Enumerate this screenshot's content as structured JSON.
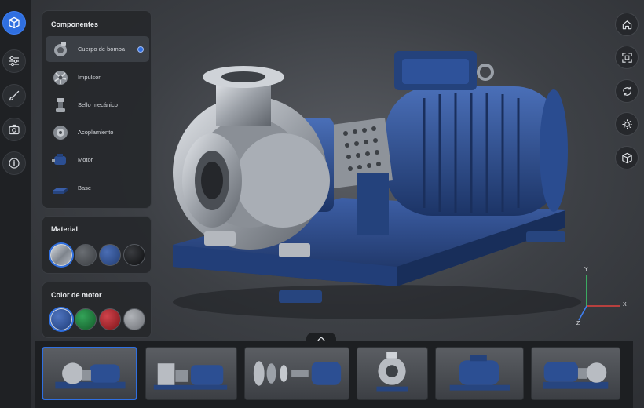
{
  "components_panel": {
    "title": "Componentes",
    "items": [
      {
        "label": "Cuerpo de bomba",
        "selected": true,
        "icon": "pump-casing-icon"
      },
      {
        "label": "Impulsor",
        "selected": false,
        "icon": "impeller-icon"
      },
      {
        "label": "Sello mecánico",
        "selected": false,
        "icon": "mechanical-seal-icon"
      },
      {
        "label": "Acoplamiento",
        "selected": false,
        "icon": "coupling-icon"
      },
      {
        "label": "Motor",
        "selected": false,
        "icon": "motor-icon"
      },
      {
        "label": "Base",
        "selected": false,
        "icon": "base-icon"
      }
    ]
  },
  "material_panel": {
    "title": "Material",
    "swatches": [
      {
        "name": "stainless-steel",
        "color": "#9aa0a8",
        "selected": true
      },
      {
        "name": "gray-iron",
        "color": "#4a4d52",
        "selected": false
      },
      {
        "name": "blue-painted",
        "color": "#2c4a86",
        "selected": false
      },
      {
        "name": "black",
        "color": "#111214",
        "selected": false
      }
    ]
  },
  "motor_color_panel": {
    "title": "Color de motor",
    "swatches": [
      {
        "name": "blue",
        "color": "#2c4f93",
        "selected": true
      },
      {
        "name": "green",
        "color": "#1f7a3a",
        "selected": false
      },
      {
        "name": "red",
        "color": "#a3242b",
        "selected": false
      },
      {
        "name": "gray",
        "color": "#8a8d92",
        "selected": false
      }
    ]
  },
  "left_rail": [
    "cube-icon",
    "sliders-icon",
    "brush-icon",
    "camera-icon",
    "info-icon"
  ],
  "right_toolbar": [
    "home-icon",
    "fit-view-icon",
    "rotate-icon",
    "lighting-icon",
    "cube-view-icon"
  ],
  "axis_gizmo": {
    "x": "X",
    "y": "Y",
    "z": "Z"
  },
  "colors": {
    "accent": "#2f6fe0",
    "motor_blue": "#2c4f93",
    "steel": "#b9bdc3"
  },
  "thumbnails": [
    {
      "view": "perspective-front-left",
      "selected": true
    },
    {
      "view": "side-left",
      "selected": false
    },
    {
      "view": "exploded",
      "selected": false
    },
    {
      "view": "front-inlet",
      "selected": false
    },
    {
      "view": "rear-motor",
      "selected": false
    },
    {
      "view": "perspective-right",
      "selected": false
    }
  ]
}
